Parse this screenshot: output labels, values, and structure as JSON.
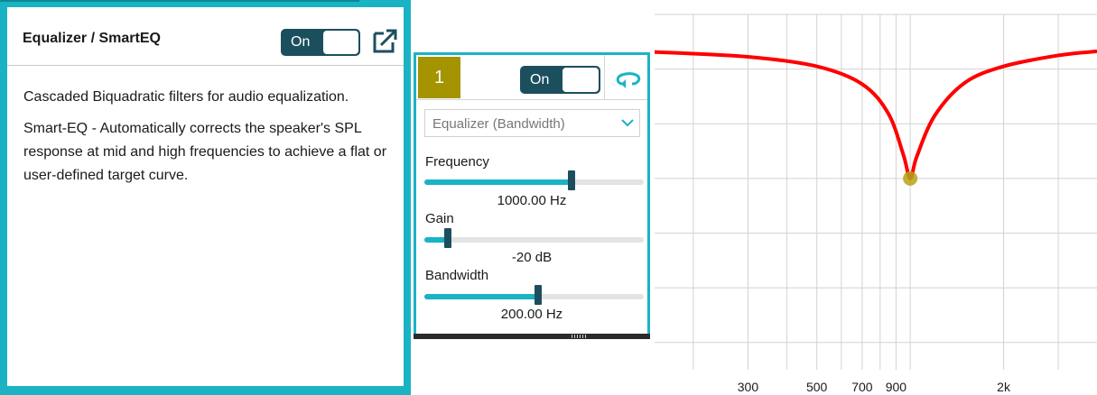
{
  "info_panel": {
    "title": "Equalizer / SmartEQ",
    "toggle_label": "On",
    "description": "Cascaded Biquadratic filters for audio equalization.",
    "smart_eq_text": "Smart-EQ - Automatically corrects the speaker's SPL response at mid and high frequencies to achieve a flat or user-defined target curve."
  },
  "filter_panel": {
    "band_number": "1",
    "toggle_label": "On",
    "filter_type": "Equalizer (Bandwidth)",
    "params": [
      {
        "label": "Frequency",
        "value": "1000.00 Hz",
        "slider_fraction": 0.67
      },
      {
        "label": "Gain",
        "value": "-20 dB",
        "slider_fraction": 0.105
      },
      {
        "label": "Bandwidth",
        "value": "200.00 Hz",
        "slider_fraction": 0.52
      }
    ]
  },
  "colors": {
    "accent": "#1ab3c4",
    "toggle_dark": "#1c4f5e",
    "band_badge": "#a39400",
    "curve": "#ff0000",
    "marker": "#b5a316"
  },
  "icons": [
    "popout-icon",
    "loop-icon",
    "chevron-down-icon"
  ],
  "chart_data": {
    "type": "line",
    "x_scale": "log",
    "tick_labels": [
      {
        "label": "300",
        "value": 300
      },
      {
        "label": "500",
        "value": 500
      },
      {
        "label": "700",
        "value": 700
      },
      {
        "label": "900",
        "value": 900
      },
      {
        "label": "2k",
        "value": 2000
      }
    ],
    "grid": true,
    "series": [
      {
        "x": [
          150,
          300,
          500,
          700,
          850,
          950,
          1000,
          1050,
          1200,
          1500,
          2000,
          3000,
          4000
        ],
        "y": [
          -1.5,
          -2.2,
          -3.6,
          -6.2,
          -10.5,
          -16.5,
          -20,
          -16.8,
          -10.8,
          -6,
          -3.6,
          -2,
          -1.4
        ]
      }
    ],
    "marker": {
      "x": 1000,
      "y": -20
    },
    "xlim": [
      150,
      4000
    ],
    "ylim": [
      -48,
      4
    ]
  }
}
